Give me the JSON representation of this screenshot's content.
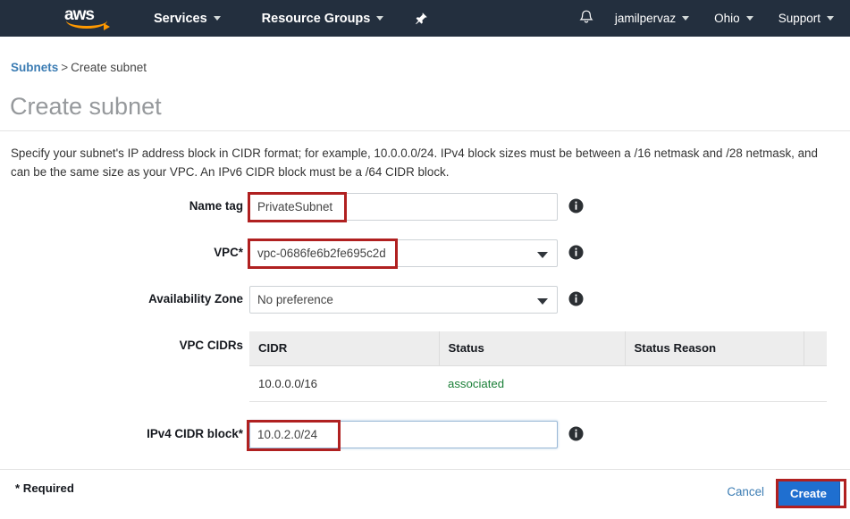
{
  "navbar": {
    "logo_text": "aws",
    "logo_name": "aws-logo",
    "items": [
      {
        "label": "Services",
        "name": "services-menu"
      },
      {
        "label": "Resource Groups",
        "name": "resource-groups-menu"
      }
    ],
    "pin_icon": "pin-icon",
    "bell_icon": "bell-icon",
    "account": "jamilpervaz",
    "region": "Ohio",
    "support": "Support"
  },
  "breadcrumb": {
    "parent": "Subnets",
    "separator": ">",
    "current": "Create subnet"
  },
  "page": {
    "title": "Create subnet",
    "description": "Specify your subnet's IP address block in CIDR format; for example, 10.0.0.0/24. IPv4 block sizes must be between a /16 netmask and /28 netmask, and can be the same size as your VPC. An IPv6 CIDR block must be a /64 CIDR block."
  },
  "form": {
    "name_tag": {
      "label": "Name tag",
      "value": "PrivateSubnet",
      "placeholder": ""
    },
    "vpc": {
      "label": "VPC*",
      "value": "vpc-0686fe6b2fe695c2d"
    },
    "availability_zone": {
      "label": "Availability Zone",
      "value": "No preference"
    },
    "vpc_cidrs": {
      "label": "VPC CIDRs",
      "columns": [
        "CIDR",
        "Status",
        "Status Reason",
        ""
      ],
      "rows": [
        {
          "cidr": "10.0.0.0/16",
          "status": "associated",
          "status_reason": "",
          "extra": ""
        }
      ]
    },
    "ipv4_cidr_block": {
      "label": "IPv4 CIDR block*",
      "value": "10.0.2.0/24"
    },
    "info_icon": "info-icon"
  },
  "footer": {
    "required_note": "* Required",
    "cancel_label": "Cancel",
    "create_label": "Create"
  },
  "colors": {
    "navbar_bg": "#232f3e",
    "accent_orange": "#ff9900",
    "link_blue": "#3b7cb3",
    "primary_button": "#1f6fd0",
    "annotation_red": "#b02020",
    "status_green": "#1a7f37",
    "title_gray": "#96999c"
  }
}
